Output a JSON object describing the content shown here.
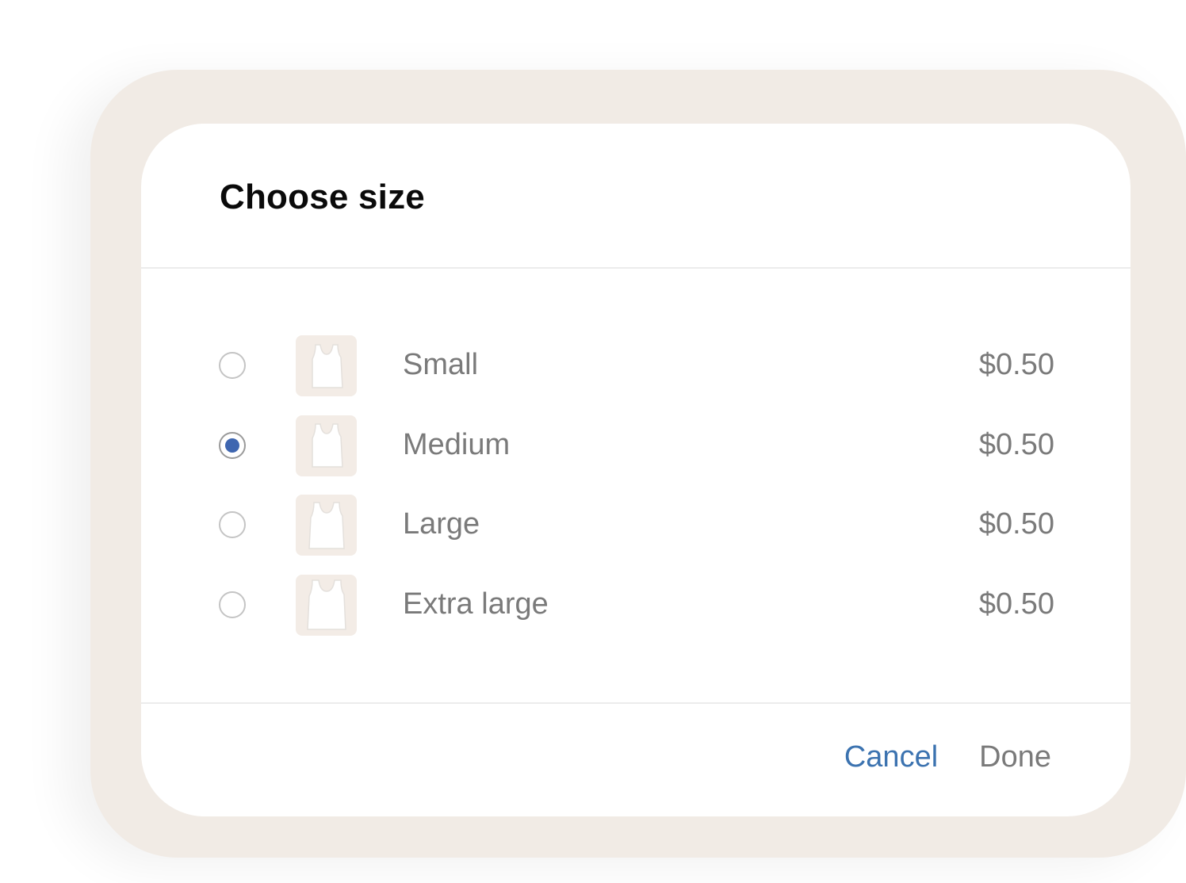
{
  "dialog": {
    "title": "Choose size",
    "options": [
      {
        "label": "Small",
        "price": "$0.50",
        "selected": false
      },
      {
        "label": "Medium",
        "price": "$0.50",
        "selected": true
      },
      {
        "label": "Large",
        "price": "$0.50",
        "selected": false
      },
      {
        "label": "Extra large",
        "price": "$0.50",
        "selected": false
      }
    ],
    "cancel_label": "Cancel",
    "done_label": "Done"
  },
  "colors": {
    "frame": "#f1ebe5",
    "accent": "#3f66b0",
    "cancel": "#3c73b0",
    "muted_text": "#7a7a7a"
  },
  "icons": {
    "thumbnail": "tank-top-icon"
  }
}
